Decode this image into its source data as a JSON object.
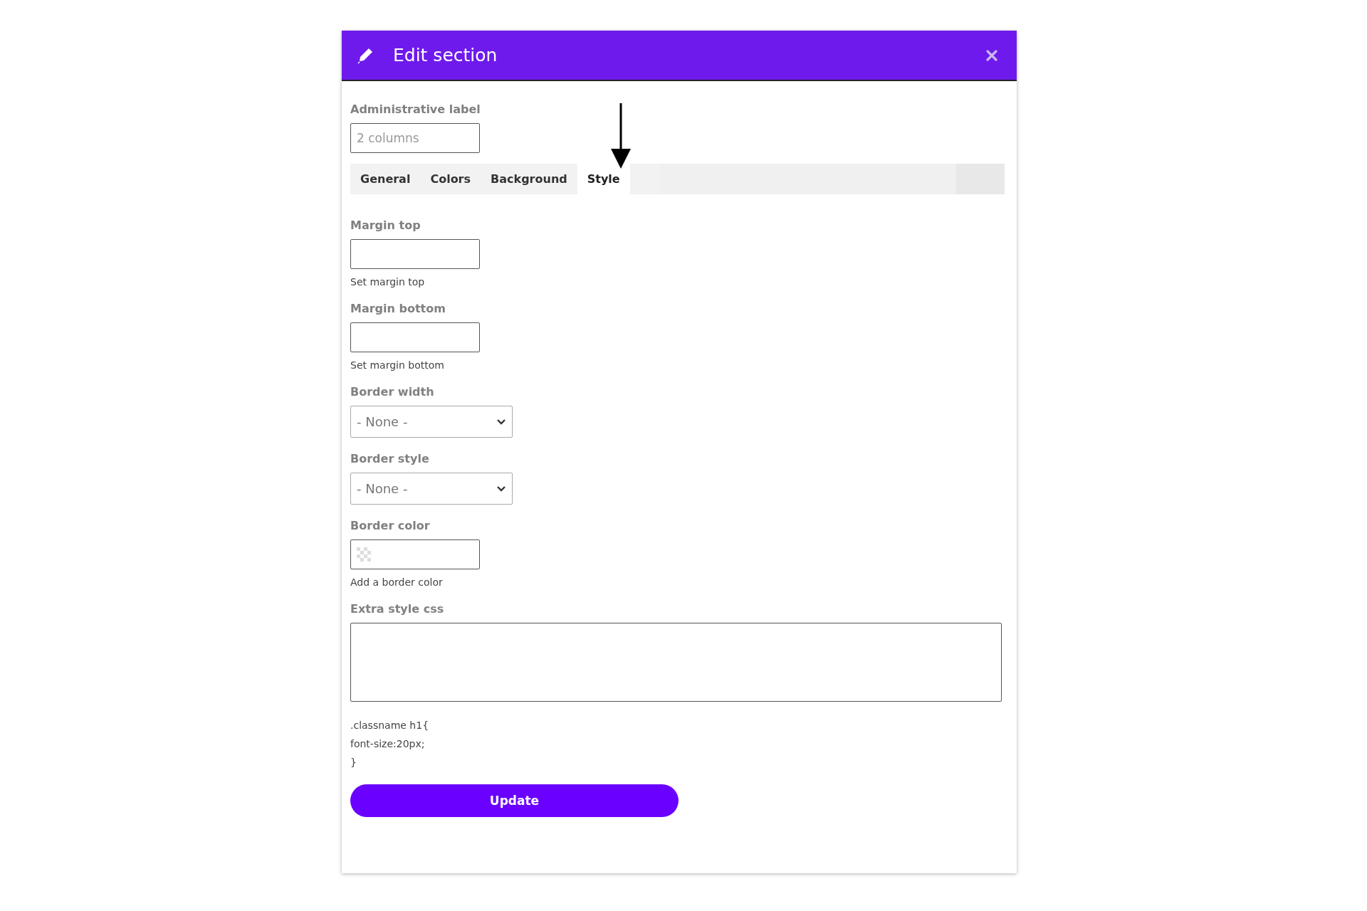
{
  "dialog": {
    "title": "Edit section"
  },
  "admin_label": {
    "label": "Administrative label",
    "placeholder": "2 columns"
  },
  "tabs": [
    {
      "label": "General",
      "selected": false
    },
    {
      "label": "Colors",
      "selected": false
    },
    {
      "label": "Background",
      "selected": false
    },
    {
      "label": "Style",
      "selected": true
    }
  ],
  "fields": [
    {
      "kind": "text",
      "label": "Margin top",
      "help": "Set margin top"
    },
    {
      "kind": "text",
      "label": "Margin bottom",
      "help": "Set margin bottom"
    },
    {
      "kind": "select",
      "label": "Border width",
      "value": "- None -"
    },
    {
      "kind": "select",
      "label": "Border style",
      "value": "- None -"
    },
    {
      "kind": "color",
      "label": "Border color",
      "help": "Add a border color"
    },
    {
      "kind": "textarea",
      "label": "Extra style css",
      "help_lines": [
        ".classname h1{",
        "font-size:20px;",
        "}"
      ]
    }
  ],
  "button": {
    "label": "Update"
  }
}
